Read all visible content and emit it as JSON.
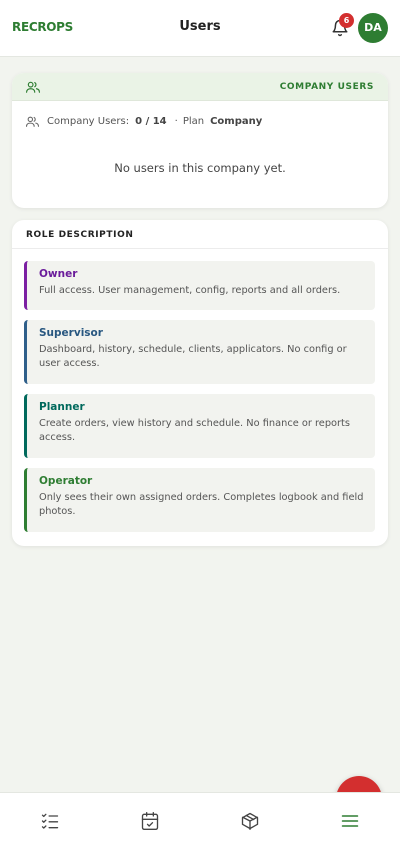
{
  "header": {
    "brand": "RECROPS",
    "title": "Users",
    "notification_count": "6",
    "avatar_initials": "DA"
  },
  "company_users_card": {
    "header_label": "COMPANY USERS",
    "company_users_label": "Company Users:",
    "company_users_count": "0 / 14",
    "separator": "·",
    "plan_label": "Plan",
    "plan_value": "Company",
    "empty_message": "No users in this company yet."
  },
  "role_description_card": {
    "header_label": "ROLE DESCRIPTION",
    "roles": [
      {
        "name": "Owner",
        "description": "Full access. User management, config, reports and all orders.",
        "color": "#7b1fa2"
      },
      {
        "name": "Supervisor",
        "description": "Dashboard, history, schedule, clients, applicators. No config or user access.",
        "color": "#2f5f8a"
      },
      {
        "name": "Planner",
        "description": "Create orders, view history and schedule. No finance or reports access.",
        "color": "#00695c"
      },
      {
        "name": "Operator",
        "description": "Only sees their own assigned orders. Completes logbook and field photos.",
        "color": "#2e7d32"
      }
    ]
  },
  "bottom_nav": {
    "items": [
      {
        "icon": "checklist-icon"
      },
      {
        "icon": "calendar-check-icon"
      },
      {
        "icon": "box-icon"
      },
      {
        "icon": "menu-icon"
      }
    ]
  },
  "colors": {
    "accent": "#2e7d32",
    "badge": "#d32f2f",
    "background": "#f2f4ef"
  }
}
